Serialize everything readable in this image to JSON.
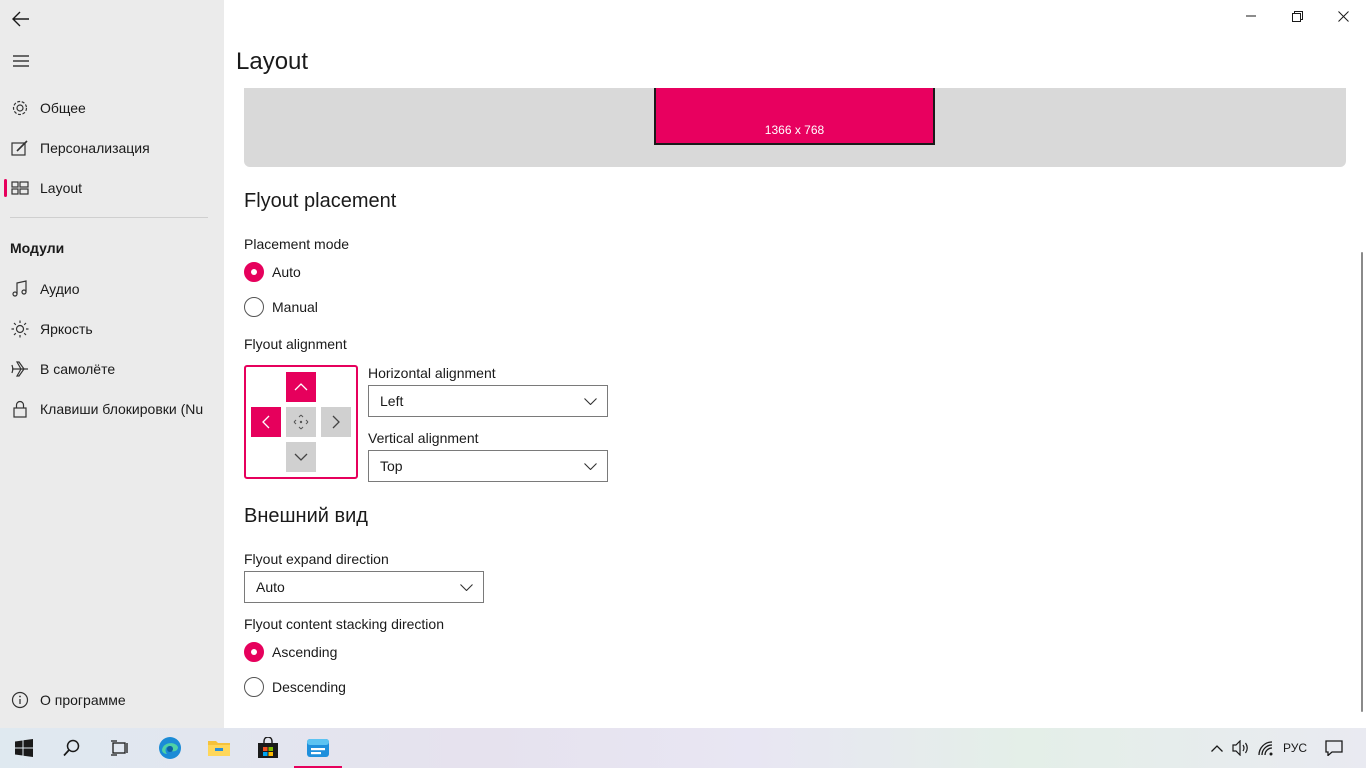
{
  "window": {
    "title": "Layout",
    "minimize_icon": "minimize-icon",
    "maximize_icon": "restore-icon",
    "close_icon": "close-icon"
  },
  "sidebar": {
    "items": [
      {
        "label": "Общее",
        "icon": "gear-icon"
      },
      {
        "label": "Персонализация",
        "icon": "personalize-icon"
      },
      {
        "label": "Layout",
        "icon": "layout-icon",
        "selected": true
      }
    ],
    "section_title": "Модули",
    "modules": [
      {
        "label": "Аудио",
        "icon": "music-icon"
      },
      {
        "label": "Яркость",
        "icon": "brightness-icon"
      },
      {
        "label": "В самолёте",
        "icon": "airplane-icon"
      },
      {
        "label": "Клавиши блокировки (Nu",
        "icon": "lock-icon"
      }
    ],
    "about": {
      "label": "О программе",
      "icon": "info-icon"
    }
  },
  "preview": {
    "resolution": "1366 x 768"
  },
  "flyout_placement": {
    "title": "Flyout placement",
    "placement_mode_label": "Placement mode",
    "options": [
      {
        "label": "Auto",
        "checked": true
      },
      {
        "label": "Manual",
        "checked": false
      }
    ],
    "alignment_label": "Flyout alignment",
    "horizontal_label": "Horizontal alignment",
    "horizontal_value": "Left",
    "vertical_label": "Vertical alignment",
    "vertical_value": "Top"
  },
  "appearance": {
    "title": "Внешний вид",
    "expand_label": "Flyout expand direction",
    "expand_value": "Auto",
    "stacking_label": "Flyout content stacking direction",
    "options": [
      {
        "label": "Ascending",
        "checked": true
      },
      {
        "label": "Descending",
        "checked": false
      }
    ]
  },
  "taskbar": {
    "language": "РУС",
    "apps": [
      "start-icon",
      "search-icon",
      "task-view-icon",
      "edge-icon",
      "file-explorer-icon",
      "store-icon",
      "flyout-app-icon"
    ]
  },
  "colors": {
    "accent": "#e6005c",
    "sidebar_bg": "#ebebeb",
    "preview_bg": "#d9d9d9"
  }
}
